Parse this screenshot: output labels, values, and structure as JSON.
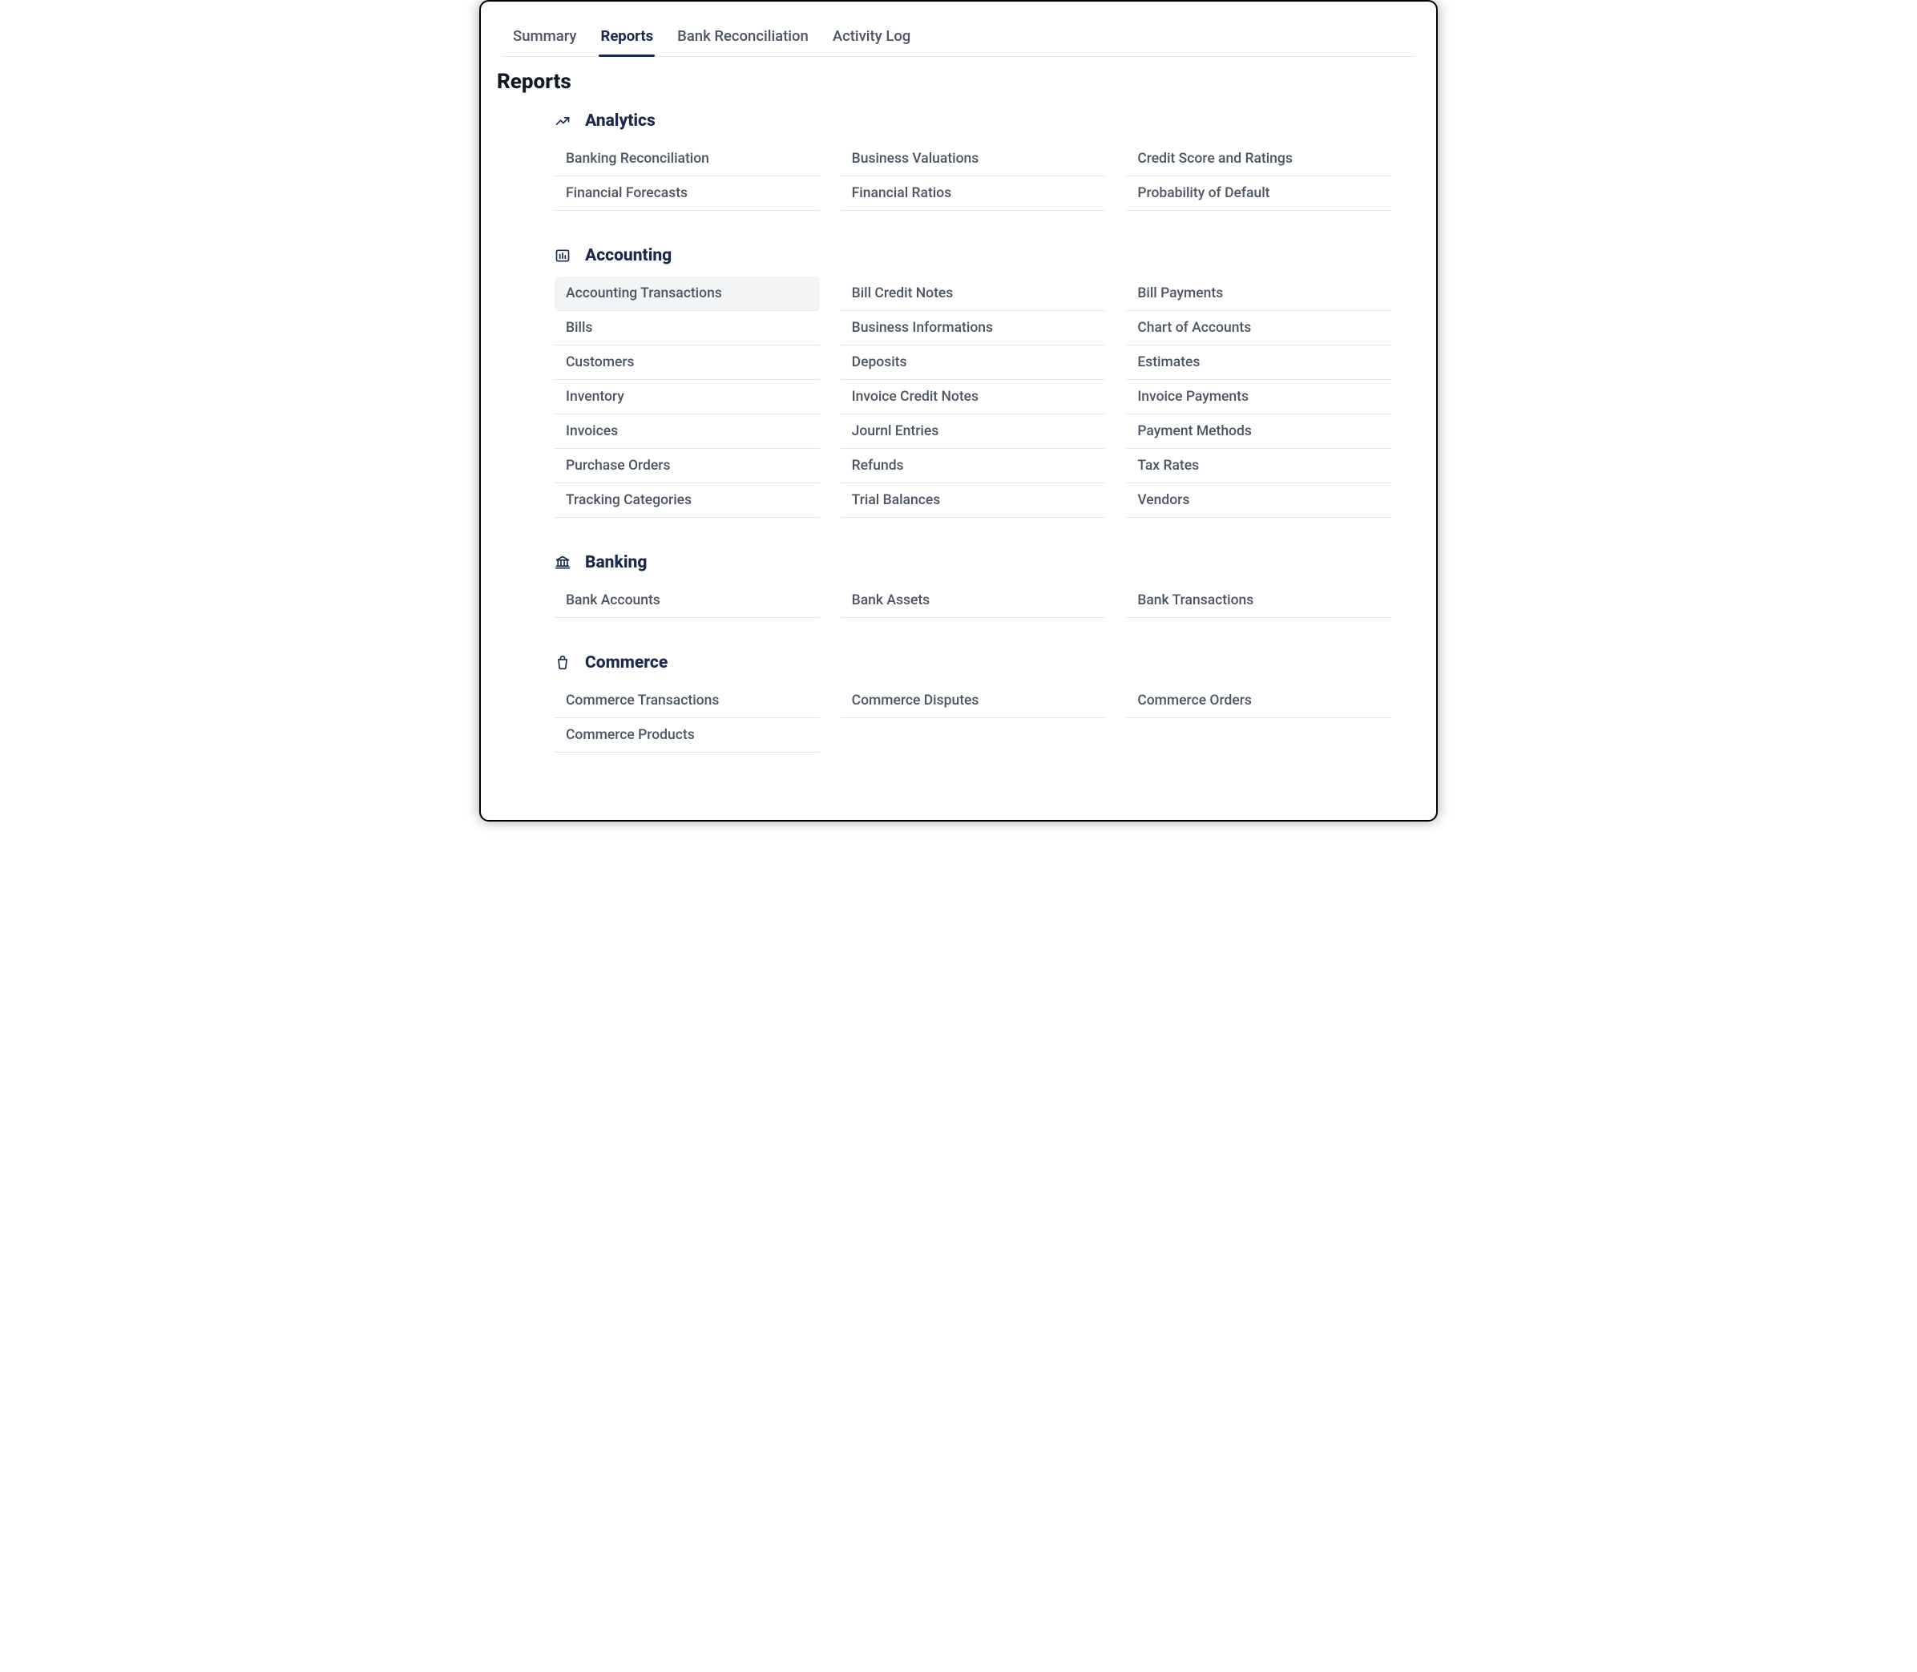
{
  "tabs": [
    {
      "id": "summary",
      "label": "Summary",
      "active": false
    },
    {
      "id": "reports",
      "label": "Reports",
      "active": true
    },
    {
      "id": "bank-reconciliation",
      "label": "Bank Reconciliation",
      "active": false
    },
    {
      "id": "activity-log",
      "label": "Activity Log",
      "active": false
    }
  ],
  "page_title": "Reports",
  "sections": [
    {
      "id": "analytics",
      "title": "Analytics",
      "icon": "analytics-icon",
      "items": [
        "Banking Reconciliation",
        "Business Valuations",
        "Credit Score and Ratings",
        "Financial Forecasts",
        "Financial Ratios",
        "Probability of Default"
      ]
    },
    {
      "id": "accounting",
      "title": "Accounting",
      "icon": "accounting-icon",
      "hoverIndex": 0,
      "items": [
        "Accounting Transactions",
        "Bill Credit Notes",
        "Bill Payments",
        "Bills",
        "Business Informations",
        "Chart of Accounts",
        "Customers",
        "Deposits",
        "Estimates",
        "Inventory",
        "Invoice Credit Notes",
        "Invoice Payments",
        "Invoices",
        "Journl Entries",
        "Payment Methods",
        "Purchase Orders",
        "Refunds",
        "Tax Rates",
        "Tracking Categories",
        "Trial Balances",
        "Vendors"
      ]
    },
    {
      "id": "banking",
      "title": "Banking",
      "icon": "banking-icon",
      "items": [
        "Bank Accounts",
        "Bank Assets",
        "Bank Transactions"
      ]
    },
    {
      "id": "commerce",
      "title": "Commerce",
      "icon": "commerce-icon",
      "items": [
        "Commerce Transactions",
        "Commerce Disputes",
        "Commerce Orders",
        "Commerce Products"
      ]
    }
  ]
}
